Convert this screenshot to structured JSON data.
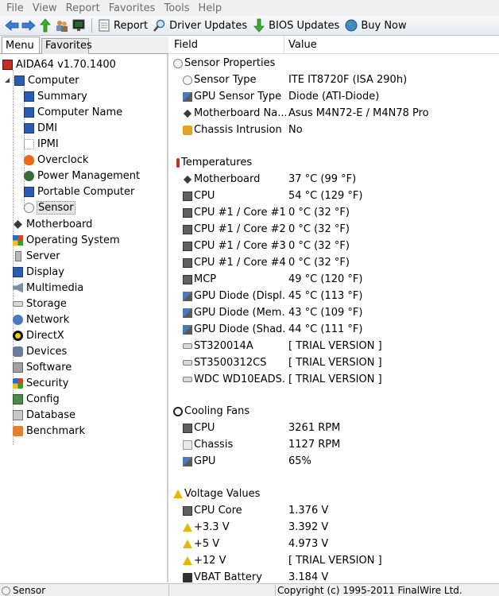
{
  "menubar": [
    "File",
    "View",
    "Report",
    "Favorites",
    "Tools",
    "Help"
  ],
  "toolbar": {
    "report": "Report",
    "driver_updates": "Driver Updates",
    "bios_updates": "BIOS Updates",
    "buy_now": "Buy Now"
  },
  "tabs": {
    "menu": "Menu",
    "favorites": "Favorites"
  },
  "tree": {
    "root": "AIDA64 v1.70.1400",
    "computer": "Computer",
    "computer_children": [
      "Summary",
      "Computer Name",
      "DMI",
      "IPMI",
      "Overclock",
      "Power Management",
      "Portable Computer",
      "Sensor"
    ],
    "sections": [
      "Motherboard",
      "Operating System",
      "Server",
      "Display",
      "Multimedia",
      "Storage",
      "Network",
      "DirectX",
      "Devices",
      "Software",
      "Security",
      "Config",
      "Database",
      "Benchmark"
    ]
  },
  "columns": {
    "field": "Field",
    "value": "Value"
  },
  "groups": {
    "sensor_properties": "Sensor Properties",
    "temperatures": "Temperatures",
    "cooling_fans": "Cooling Fans",
    "voltage_values": "Voltage Values"
  },
  "sensor_properties": [
    {
      "field": "Sensor Type",
      "value": "ITE IT8720F  (ISA 290h)",
      "icon": "sensor-icon"
    },
    {
      "field": "GPU Sensor Type",
      "value": "Diode  (ATI-Diode)",
      "icon": "gpu-icon"
    },
    {
      "field": "Motherboard Na...",
      "value": "Asus M4N72-E / M4N78 Pro",
      "icon": "motherboard-icon"
    },
    {
      "field": "Chassis Intrusion ...",
      "value": "No",
      "icon": "lock-icon"
    }
  ],
  "temperatures": [
    {
      "field": "Motherboard",
      "value": "37 °C  (99 °F)",
      "icon": "motherboard-icon"
    },
    {
      "field": "CPU",
      "value": "54 °C  (129 °F)",
      "icon": "cpu-icon"
    },
    {
      "field": "CPU #1 / Core #1",
      "value": "0 °C  (32 °F)",
      "icon": "cpu-icon"
    },
    {
      "field": "CPU #1 / Core #2",
      "value": "0 °C  (32 °F)",
      "icon": "cpu-icon"
    },
    {
      "field": "CPU #1 / Core #3",
      "value": "0 °C  (32 °F)",
      "icon": "cpu-icon"
    },
    {
      "field": "CPU #1 / Core #4",
      "value": "0 °C  (32 °F)",
      "icon": "cpu-icon"
    },
    {
      "field": "MCP",
      "value": "49 °C  (120 °F)",
      "icon": "chip-icon"
    },
    {
      "field": "GPU Diode (Displ...",
      "value": "45 °C  (113 °F)",
      "icon": "gpu-icon"
    },
    {
      "field": "GPU Diode (Mem...",
      "value": "43 °C  (109 °F)",
      "icon": "gpu-icon"
    },
    {
      "field": "GPU Diode (Shad...",
      "value": "44 °C  (111 °F)",
      "icon": "gpu-icon"
    },
    {
      "field": "ST320014A",
      "value": "[ TRIAL VERSION ]",
      "icon": "disk-icon"
    },
    {
      "field": "ST3500312CS",
      "value": "[ TRIAL VERSION ]",
      "icon": "disk-icon"
    },
    {
      "field": "WDC WD10EADS...",
      "value": "[ TRIAL VERSION ]",
      "icon": "disk-icon"
    }
  ],
  "cooling_fans": [
    {
      "field": "CPU",
      "value": "3261 RPM",
      "icon": "cpu-icon"
    },
    {
      "field": "Chassis",
      "value": "1127 RPM",
      "icon": "case-icon"
    },
    {
      "field": "GPU",
      "value": "65%",
      "icon": "gpu-icon"
    }
  ],
  "voltage_values": [
    {
      "field": "CPU Core",
      "value": "1.376 V",
      "icon": "cpu-icon"
    },
    {
      "field": "+3.3 V",
      "value": "3.392 V",
      "icon": "warning-icon"
    },
    {
      "field": "+5 V",
      "value": "4.973 V",
      "icon": "warning-icon"
    },
    {
      "field": "+12 V",
      "value": "[ TRIAL VERSION ]",
      "icon": "warning-icon"
    },
    {
      "field": "VBAT Battery",
      "value": "3.184 V",
      "icon": "battery-icon"
    }
  ],
  "statusbar": {
    "left": "Sensor",
    "right": "Copyright (c) 1995-2011 FinalWire Ltd."
  }
}
